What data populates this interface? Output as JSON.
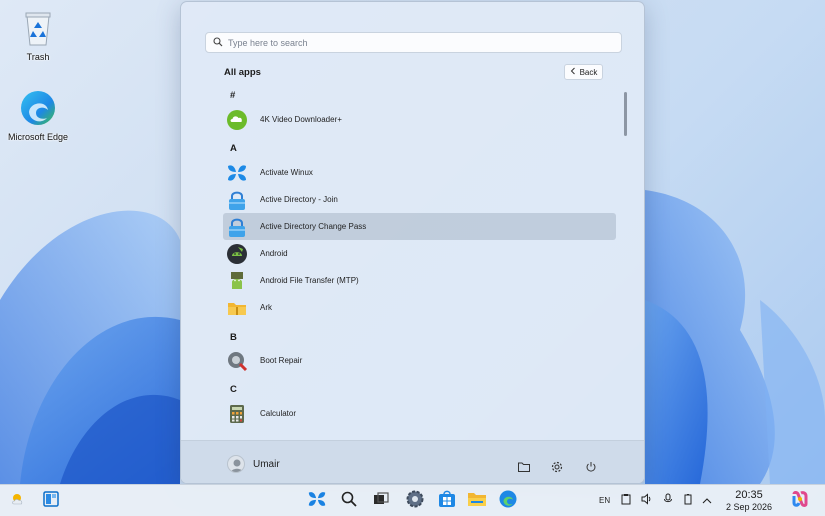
{
  "desktop": {
    "icons": [
      {
        "label": "Trash",
        "icon": "recycle-bin-icon"
      },
      {
        "label": "Microsoft Edge",
        "icon": "edge-icon"
      }
    ]
  },
  "start_menu": {
    "search": {
      "placeholder": "Type here to search",
      "value": ""
    },
    "title": "All apps",
    "back_label": "Back",
    "groups": [
      {
        "letter": "#",
        "apps": [
          {
            "name": "4K Video Downloader+",
            "icon": "cloud-download-icon"
          }
        ]
      },
      {
        "letter": "A",
        "apps": [
          {
            "name": "Activate Winux",
            "icon": "windows-logo-icon"
          },
          {
            "name": "Active Directory - Join",
            "icon": "lock-icon"
          },
          {
            "name": "Active Directory Change Pass",
            "icon": "lock-icon",
            "highlighted": true
          },
          {
            "name": "Android",
            "icon": "android-icon"
          },
          {
            "name": "Android File Transfer (MTP)",
            "icon": "android-robot-icon"
          },
          {
            "name": "Ark",
            "icon": "archive-folder-icon"
          }
        ]
      },
      {
        "letter": "B",
        "apps": [
          {
            "name": "Boot Repair",
            "icon": "boot-repair-icon"
          }
        ]
      },
      {
        "letter": "C",
        "apps": [
          {
            "name": "Calculator",
            "icon": "calculator-icon"
          }
        ]
      }
    ],
    "footer": {
      "user_name": "Umair",
      "buttons": [
        "folder-icon",
        "settings-gear-icon",
        "power-icon"
      ]
    }
  },
  "taskbar": {
    "pinned": [
      "widgets-icon",
      "start-icon",
      "search-icon",
      "task-view-icon",
      "settings-icon",
      "store-icon",
      "file-explorer-icon",
      "edge-icon"
    ],
    "tray": {
      "language": "EN",
      "time": "20:35",
      "date": "2 Sep 2026"
    }
  },
  "colors": {
    "accent": "#0a78d7",
    "highlight": "#c3cad6"
  }
}
